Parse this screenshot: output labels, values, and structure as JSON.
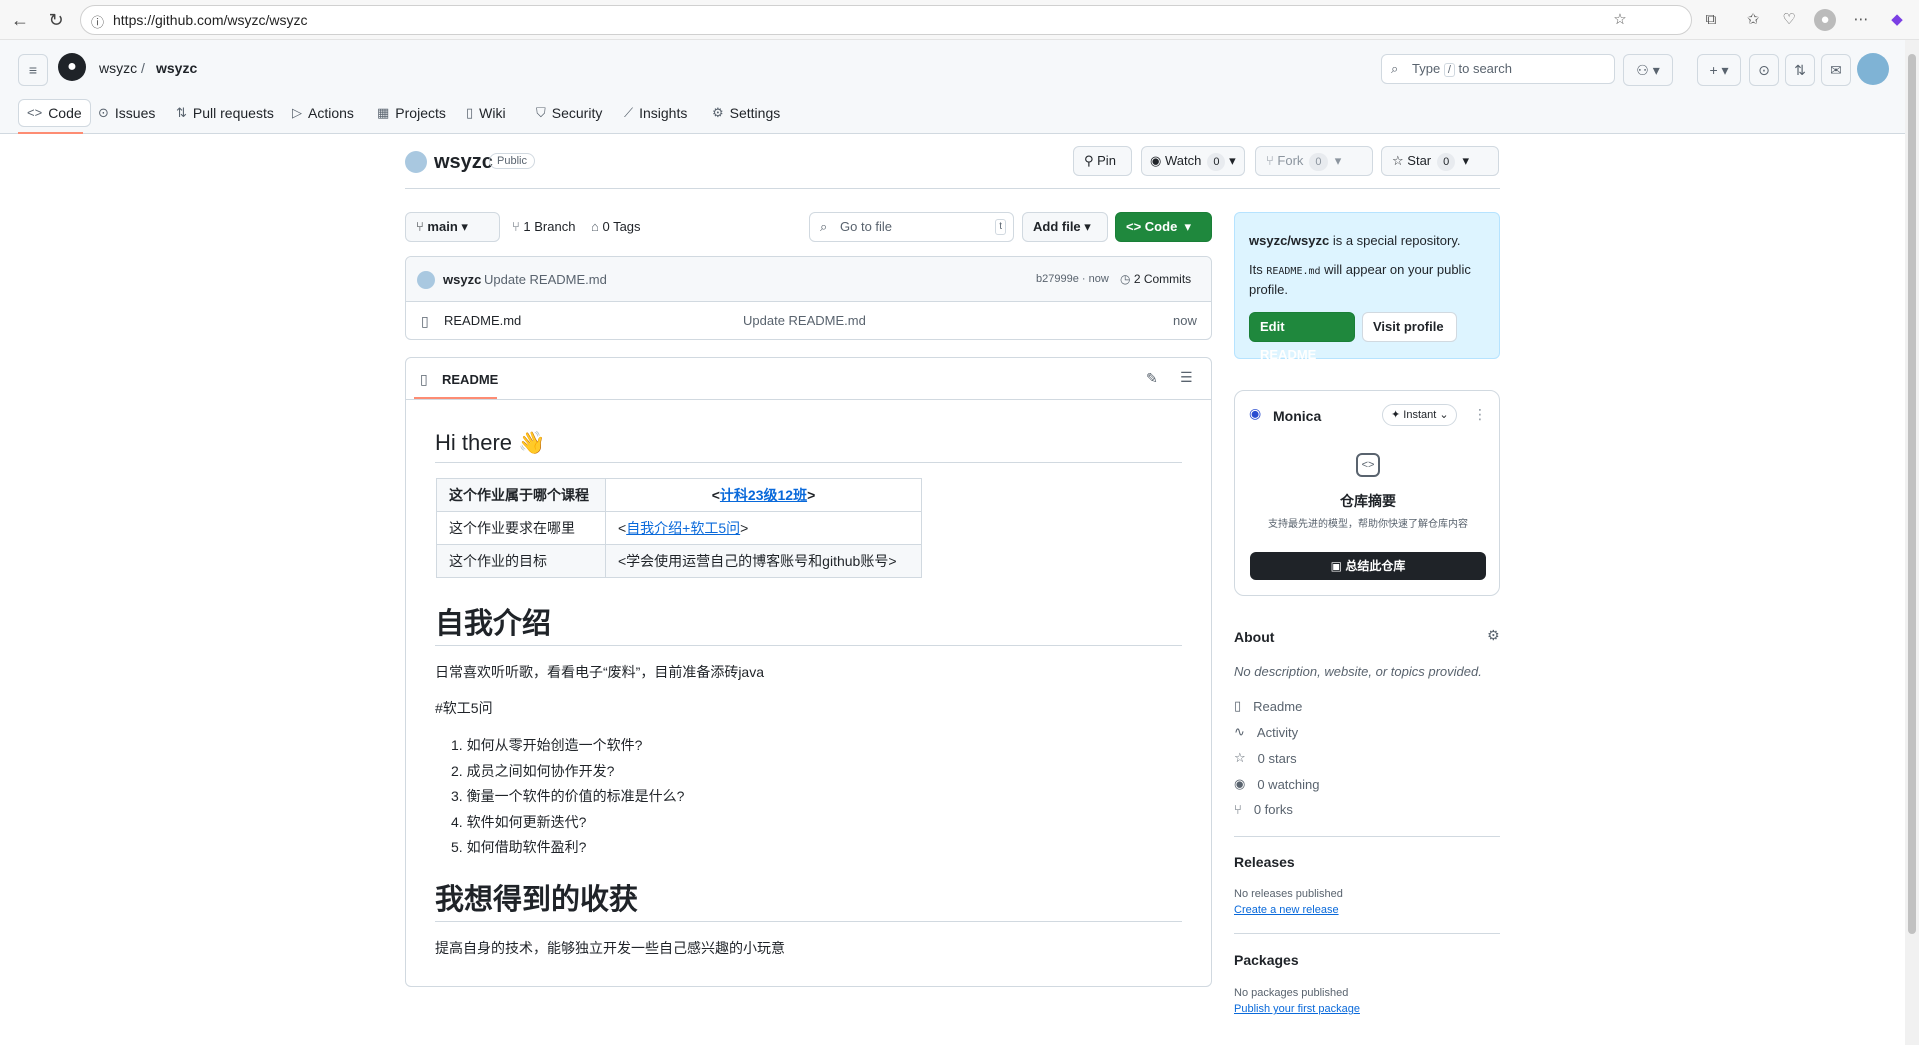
{
  "browser": {
    "url": "https://github.com/wsyzc/wsyzc"
  },
  "header": {
    "owner": "wsyzc",
    "separator": "/",
    "repo": "wsyzc",
    "search_prefix": "Type",
    "search_key": "/",
    "search_suffix": "to search"
  },
  "tabs": [
    {
      "label": "Code",
      "icon": "code-icon"
    },
    {
      "label": "Issues",
      "icon": "issue-icon"
    },
    {
      "label": "Pull requests",
      "icon": "pull-request-icon"
    },
    {
      "label": "Actions",
      "icon": "play-icon"
    },
    {
      "label": "Projects",
      "icon": "table-icon"
    },
    {
      "label": "Wiki",
      "icon": "book-icon"
    },
    {
      "label": "Security",
      "icon": "shield-icon"
    },
    {
      "label": "Insights",
      "icon": "graph-icon"
    },
    {
      "label": "Settings",
      "icon": "gear-icon"
    }
  ],
  "repo": {
    "name": "wsyzc",
    "visibility": "Public",
    "pin": "Pin",
    "watch": "Watch",
    "watch_count": "0",
    "fork": "Fork",
    "fork_count": "0",
    "star": "Star",
    "star_count": "0"
  },
  "toolbar": {
    "branch": "main",
    "branch_count": "1 Branch",
    "tag_count": "0 Tags",
    "goto_placeholder": "Go to file",
    "goto_key": "t",
    "add_file": "Add file",
    "code": "Code"
  },
  "commit": {
    "author": "wsyzc",
    "message": "Update README.md",
    "hash": "b27999e · now",
    "commits": "2 Commits"
  },
  "files": [
    {
      "name": "README.md",
      "message": "Update README.md",
      "time": "now"
    }
  ],
  "readme": {
    "tab": "README",
    "h1": "Hi there 👋",
    "table": [
      [
        "这个作业属于哪个课程",
        "<",
        "计科23级12班",
        ">"
      ],
      [
        "这个作业要求在哪里",
        "<",
        "自我介绍+软工5问",
        ">"
      ],
      [
        "这个作业的目标",
        "<学会使用运营自己的博客账号和github账号>",
        "",
        ""
      ]
    ],
    "h2_intro": "自我介绍",
    "p_intro": "日常喜欢听听歌，看看电子“废料”，目前准备添砖java",
    "p_tag": "#软工5问",
    "questions": [
      "如何从零开始创造一个软件?",
      "成员之间如何协作开发?",
      "衡量一个软件的价值的标准是什么?",
      "软件如何更新迭代?",
      "如何借助软件盈利?"
    ],
    "h2_goal": "我想得到的收获",
    "p_goal": "提高自身的技术，能够独立开发一些自己感兴趣的小玩意"
  },
  "special": {
    "line1_bold": "wsyzc/wsyzc",
    "line1_rest": " is a special repository.",
    "line2_pre": "Its ",
    "line2_code": "README.md",
    "line2_post": " will appear on your public profile.",
    "edit": "Edit README",
    "visit": "Visit profile"
  },
  "monica": {
    "name": "Monica",
    "mode": "Instant",
    "title": "仓库摘要",
    "subtitle": "支持最先进的模型，帮助你快速了解仓库内容",
    "button": "总结此仓库"
  },
  "about": {
    "title": "About",
    "desc": "No description, website, or topics provided.",
    "items": [
      {
        "label": "Readme",
        "icon": "book-icon"
      },
      {
        "label": "Activity",
        "icon": "pulse-icon"
      },
      {
        "label": "0 stars",
        "icon": "star-icon"
      },
      {
        "label": "0 watching",
        "icon": "eye-icon"
      },
      {
        "label": "0 forks",
        "icon": "fork-icon"
      }
    ]
  },
  "releases": {
    "title": "Releases",
    "none": "No releases published",
    "link": "Create a new release"
  },
  "packages": {
    "title": "Packages",
    "none": "No packages published",
    "link": "Publish your first package"
  },
  "colors": {
    "accent_green": "#1f883d",
    "link_blue": "#0969da",
    "tab_underline": "#fd8c73",
    "special_bg": "#ddf4ff"
  }
}
